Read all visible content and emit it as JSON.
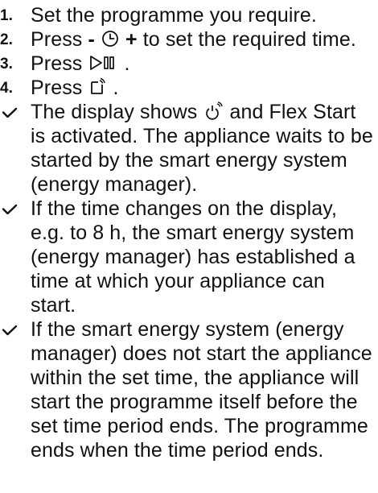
{
  "steps": [
    {
      "number": "1.",
      "text": "Set the programme you require."
    },
    {
      "number": "2.",
      "before": "Press",
      "minus": "-",
      "plus": "+",
      "after": "to set the required time."
    },
    {
      "number": "3.",
      "before": "Press",
      "after": "."
    },
    {
      "number": "4.",
      "before": "Press",
      "after": "."
    }
  ],
  "results": [
    {
      "before": "The display shows",
      "after": "and Flex Start is activated. The appliance waits to be started by the smart energy system (energy manager)."
    },
    {
      "text": "If the time changes on the display, e.g. to 8 h, the smart energy sys­tem (energy manager) has estab­lished a time at which your appli­ance can start."
    },
    {
      "text": "If the smart energy system (energy manager) does not start the appli­ance within the set time, the appli­ance will start the programme itself before the set time period ends. The programme ends when the time period ends."
    }
  ],
  "icons": {
    "timer": "clock-timer-icon",
    "start_pause": "start-pause-icon",
    "remote_start": "remote-start-icon",
    "flex_start": "flex-start-icon",
    "result_marker": "checkmark-icon"
  }
}
